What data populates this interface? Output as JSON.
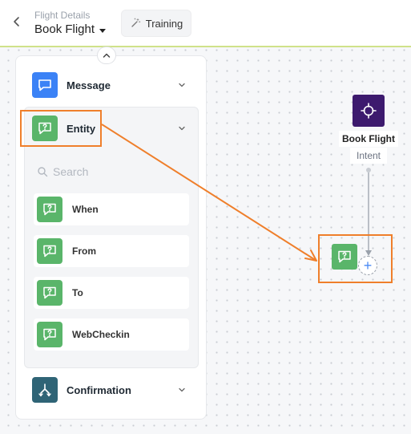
{
  "header": {
    "breadcrumb": "Flight Details",
    "title": "Book Flight",
    "training_label": "Training"
  },
  "palette": {
    "search_placeholder": "Search",
    "categories": [
      {
        "label": "Message",
        "icon": "chat-bubble-icon",
        "color": "#3b82f6"
      },
      {
        "label": "Entity",
        "icon": "question-bubble-icon",
        "color": "#5ab56a"
      },
      {
        "label": "Confirmation",
        "icon": "fork-arrows-icon",
        "color": "#2f6476"
      }
    ],
    "entity_items": [
      {
        "label": "When"
      },
      {
        "label": "From"
      },
      {
        "label": "To"
      },
      {
        "label": "WebCheckin"
      }
    ]
  },
  "canvas": {
    "intent_node": {
      "name": "Book Flight",
      "type": "Intent",
      "color": "#3d1a6e"
    },
    "add_symbol": "+"
  },
  "colors": {
    "highlight": "#ef7f2b",
    "accent_line": "#cfe28a"
  }
}
